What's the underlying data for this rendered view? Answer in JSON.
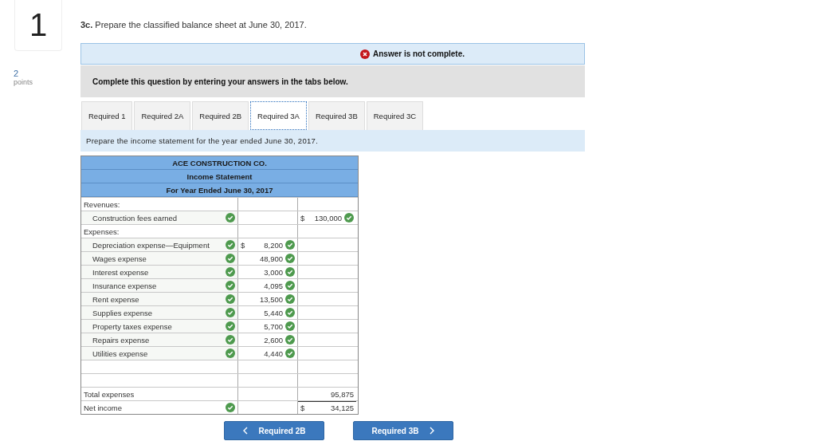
{
  "question": {
    "number": "1",
    "points": "2",
    "points_label": "points",
    "prompt": "**3c.** Prepare the classified balance sheet at June 30, 2017."
  },
  "status": {
    "kind": "incomplete",
    "message": "Answer is not complete."
  },
  "instructions": "Complete this question by entering your answers in the tabs below.",
  "tabs": [
    {
      "label": "Required 1",
      "selected": false
    },
    {
      "label": "Required 2A",
      "selected": false
    },
    {
      "label": "Required 2B",
      "selected": false
    },
    {
      "label": "Required 3A",
      "selected": true
    },
    {
      "label": "Required 3B",
      "selected": false
    },
    {
      "label": "Required 3C",
      "selected": false
    }
  ],
  "tab_prompt": "Prepare the income statement for the year ended June 30, 2017.",
  "statement": {
    "headers": [
      "ACE CONSTRUCTION CO.",
      "Income Statement",
      "For Year Ended June 30, 2017"
    ],
    "rows": [
      {
        "label": "Revenues:",
        "indented": false
      },
      {
        "label": "Construction fees earned",
        "indented": true,
        "label_checked": true,
        "col_3": {
          "currency": "$",
          "amount": "130,000",
          "checked": true
        }
      },
      {
        "label": "Expenses:",
        "indented": false
      },
      {
        "label": "Depreciation expense—Equipment",
        "indented": true,
        "label_checked": true,
        "col_2": {
          "currency": "$",
          "amount": "8,200",
          "checked": true
        }
      },
      {
        "label": "Wages expense",
        "indented": true,
        "label_checked": true,
        "col_2": {
          "amount": "48,900",
          "checked": true
        }
      },
      {
        "label": "Interest expense",
        "indented": true,
        "label_checked": true,
        "col_2": {
          "amount": "3,000",
          "checked": true
        }
      },
      {
        "label": "Insurance expense",
        "indented": true,
        "label_checked": true,
        "col_2": {
          "amount": "4,095",
          "checked": true
        }
      },
      {
        "label": "Rent expense",
        "indented": true,
        "label_checked": true,
        "col_2": {
          "amount": "13,500",
          "checked": true
        }
      },
      {
        "label": "Supplies expense",
        "indented": true,
        "label_checked": true,
        "col_2": {
          "amount": "5,440",
          "checked": true
        }
      },
      {
        "label": "Property taxes expense",
        "indented": true,
        "label_checked": true,
        "col_2": {
          "amount": "5,700",
          "checked": true
        }
      },
      {
        "label": "Repairs expense",
        "indented": true,
        "label_checked": true,
        "col_2": {
          "amount": "2,600",
          "checked": true
        }
      },
      {
        "label": "Utilities expense",
        "indented": true,
        "label_checked": true,
        "col_2": {
          "amount": "4,440",
          "checked": true
        }
      },
      {},
      {},
      {
        "label": "Total expenses",
        "indented": false,
        "col_3": {
          "amount": "95,875"
        }
      },
      {
        "label": "Net income",
        "indented": false,
        "label_checked": true,
        "col_3": {
          "currency": "$",
          "amount": "34,125"
        }
      }
    ]
  },
  "navigation": {
    "previous": "Required 2B",
    "next": "Required 3B"
  }
}
